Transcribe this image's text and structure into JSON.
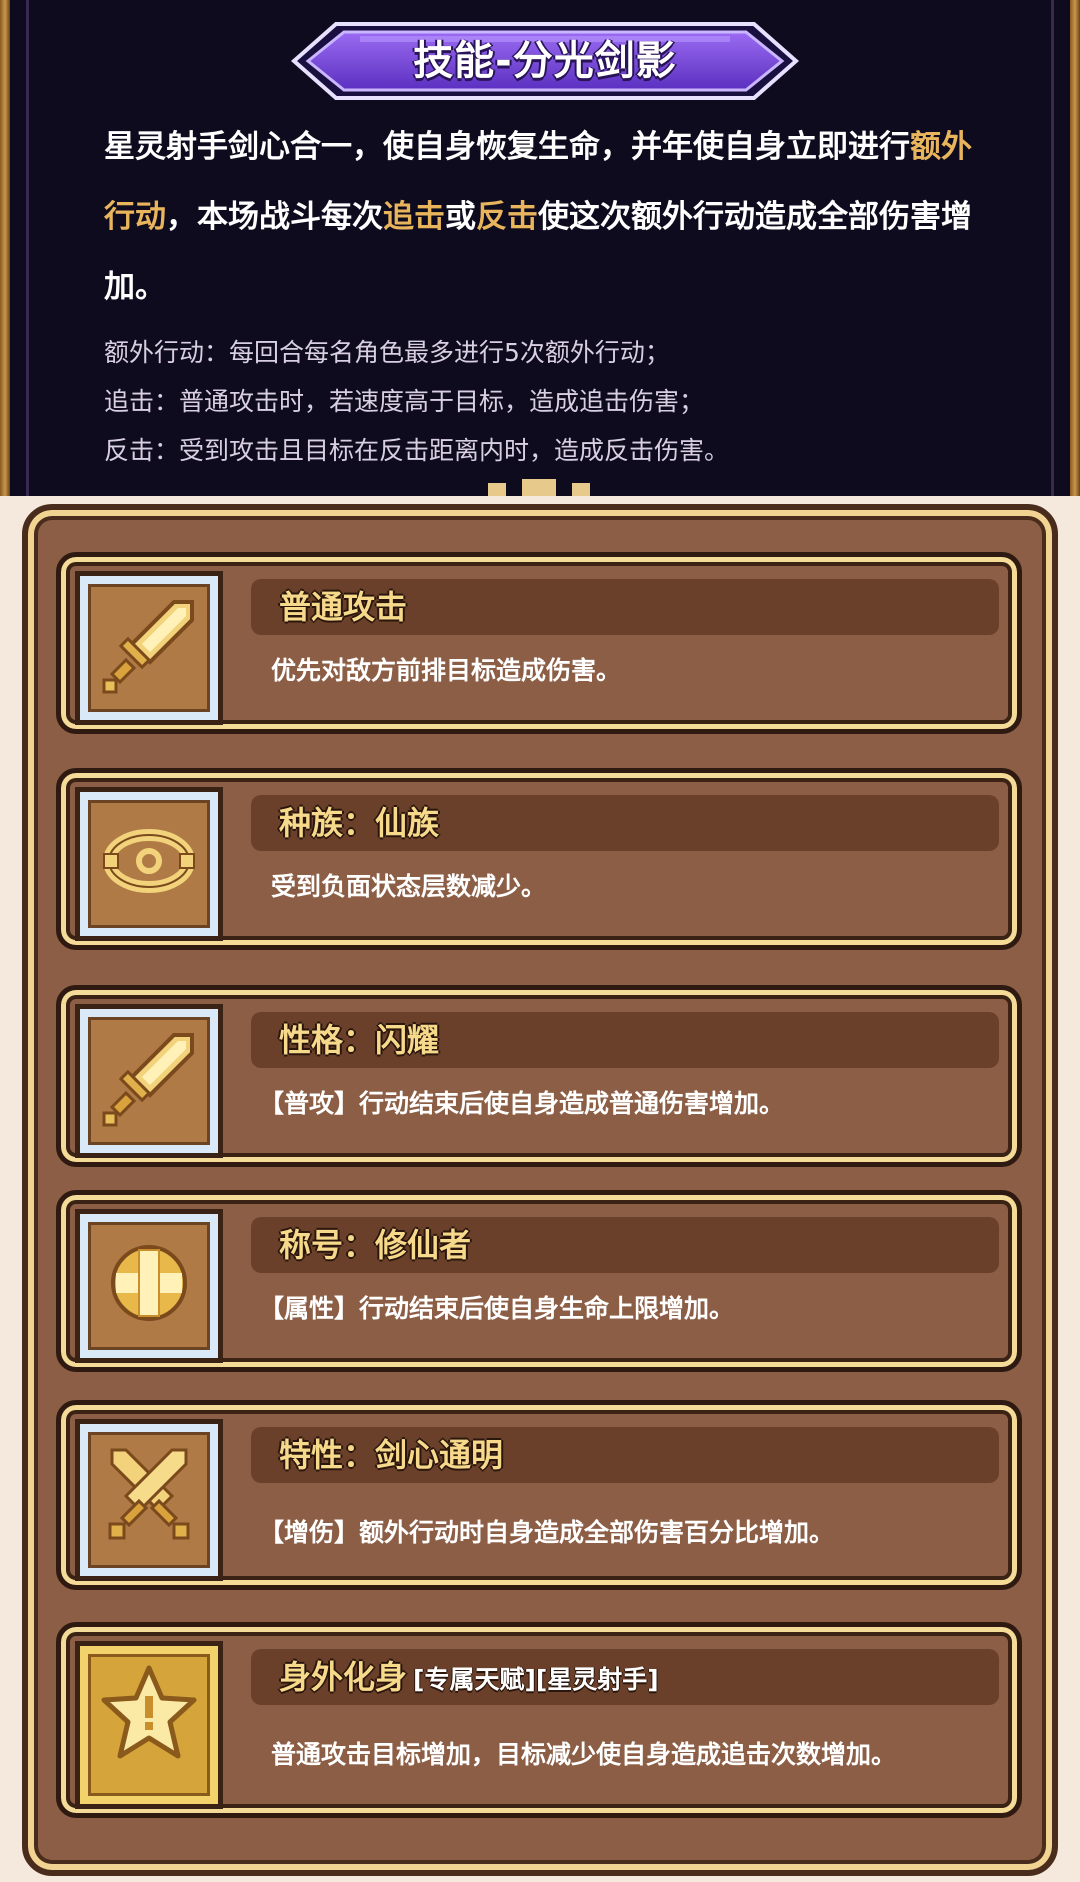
{
  "skill": {
    "title": "技能-分光剑影",
    "description": [
      {
        "text": "星灵射手剑心合一，使自身恢复生命，并年使自身立即进行",
        "hl": false
      },
      {
        "text": "额外行动",
        "hl": true
      },
      {
        "text": "，本场战斗每次",
        "hl": false
      },
      {
        "text": "追击",
        "hl": true
      },
      {
        "text": "或",
        "hl": false
      },
      {
        "text": "反击",
        "hl": true
      },
      {
        "text": "使这次额外行动造成全部伤害增加。",
        "hl": false
      }
    ],
    "notes": [
      "额外行动：每回合每名角色最多进行5次额外行动；",
      "追击：普通攻击时，若速度高于目标，造成追击伤害；",
      "反击：受到攻击且目标在反击距离内时，造成反击伤害。"
    ],
    "highlight_color": "#e8b55c"
  },
  "traits": [
    {
      "name": "普通攻击",
      "tag": "",
      "desc": "优先对敌方前排目标造成伤害。",
      "icon": "sword-icon",
      "frame": "blue"
    },
    {
      "name": "种族：仙族",
      "tag": "",
      "desc": "受到负面状态层数减少。",
      "icon": "halo-ring-icon",
      "frame": "blue"
    },
    {
      "name": "性格：闪耀",
      "tag": "",
      "desc": "【普攻】行动结束后使自身造成普通伤害增加。",
      "icon": "sword-icon",
      "frame": "blue"
    },
    {
      "name": "称号：修仙者",
      "tag": "",
      "desc": "【属性】行动结束后使自身生命上限增加。",
      "icon": "plus-cross-icon",
      "frame": "blue"
    },
    {
      "name": "特性：剑心通明",
      "tag": "",
      "desc": "【增伤】额外行动时自身造成全部伤害百分比增加。",
      "icon": "crossed-swords-icon",
      "frame": "blue"
    },
    {
      "name": "身外化身",
      "tag": "[专属天赋][星灵射手]",
      "desc": "普通攻击目标增加，目标减少使自身造成追击次数增加。",
      "icon": "star-icon",
      "frame": "gold"
    }
  ]
}
